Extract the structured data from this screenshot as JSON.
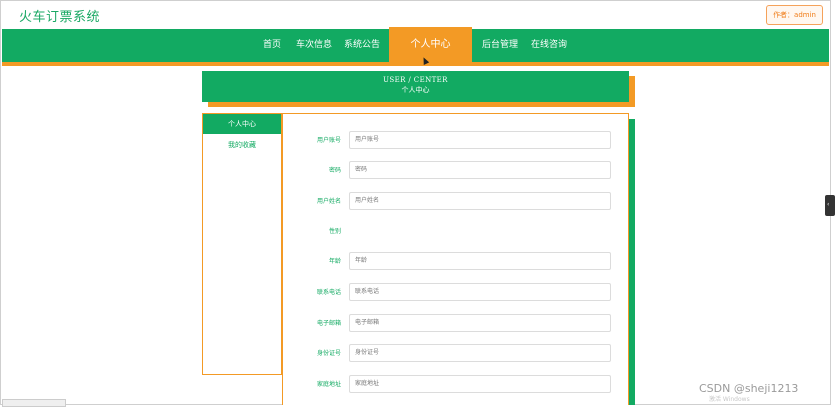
{
  "header": {
    "site_title": "火车订票系统",
    "author_badge": "作者：admin"
  },
  "nav": {
    "items": [
      "首页",
      "车次信息",
      "系统公告",
      "个人中心",
      "后台管理",
      "在线咨询"
    ],
    "active_label": "个人中心"
  },
  "banner": {
    "english": "USER / CENTER",
    "chinese": "个人中心"
  },
  "menu": {
    "items": [
      "个人中心",
      "我的收藏"
    ]
  },
  "form": {
    "fields": [
      {
        "label": "用户账号",
        "placeholder": "用户账号"
      },
      {
        "label": "密码",
        "placeholder": "密码"
      },
      {
        "label": "用户姓名",
        "placeholder": "用户姓名"
      },
      {
        "label": "性别",
        "placeholder": ""
      },
      {
        "label": "年龄",
        "placeholder": "年龄"
      },
      {
        "label": "联系电话",
        "placeholder": "联系电话"
      },
      {
        "label": "电子邮箱",
        "placeholder": "电子邮箱"
      },
      {
        "label": "身份证号",
        "placeholder": "身份证号"
      },
      {
        "label": "家庭地址",
        "placeholder": "家庭地址"
      }
    ]
  },
  "watermarks": {
    "csdn": "CSDN @sheji1213",
    "windows": "激活 Windows"
  },
  "colors": {
    "primary": "#12aa62",
    "accent": "#f39a25"
  }
}
